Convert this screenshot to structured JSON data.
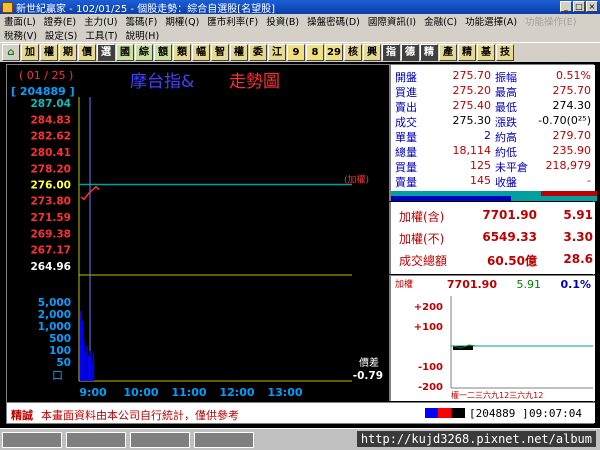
{
  "window": {
    "title": "新世紀贏家 - 102/01/25 - 個股走勢：綜合自選股[名望股]"
  },
  "menus": {
    "row1": [
      "畫面(L)",
      "證券(E)",
      "主力(U)",
      "籌碼(F)",
      "期權(Q)",
      "匯市利率(F)",
      "投資(B)",
      "操盤密碼(D)",
      "國際資訊(I)",
      "金融(C)",
      "功能選擇(A)",
      "功能操作(E)"
    ],
    "row2": [
      "稅務(V)",
      "設定(S)",
      "工具(T)",
      "說明(H)"
    ]
  },
  "toolbar": {
    "buttons": [
      "加",
      "權",
      "期",
      "價",
      "選",
      "國",
      "綜",
      "額",
      "類",
      "幅",
      "智",
      "權",
      "委",
      "江",
      "9",
      "8",
      "29",
      "核",
      "興",
      "指",
      "德",
      "精",
      "產",
      "精",
      "基",
      "技"
    ]
  },
  "chart": {
    "page": "( 01 / 25 )",
    "code": "[ 204889 ]",
    "title_a": "摩台指&",
    "title_b": "走勢圖",
    "ref_label": "(加權)",
    "diff_label": "價差",
    "diff_value": "-0.79",
    "volume_box": "口",
    "colors": {
      "up": "#ff3030",
      "down": "#00c000",
      "ref": "#ffffff",
      "axis": "#c0c000",
      "grid": "#00a0a0",
      "vol": "#0000ff"
    }
  },
  "chart_data": {
    "type": "line",
    "title": "摩台指& 走勢圖",
    "price_ticks": [
      "287.04",
      "284.83",
      "282.62",
      "280.41",
      "278.20",
      "276.00",
      "273.80",
      "271.59",
      "269.38",
      "267.17",
      "264.96"
    ],
    "volume_ticks": [
      "5,000",
      "2,000",
      "1,000",
      "500",
      "100",
      "50"
    ],
    "time_ticks": [
      "9:00",
      "10:00",
      "11:00",
      "12:00",
      "13:00"
    ],
    "ylim": [
      264.96,
      287.04
    ],
    "reference_price": 276.0,
    "series": [
      {
        "values": [
          274.3,
          274.0,
          274.5,
          275.0,
          275.3,
          275.7,
          275.3
        ]
      }
    ]
  },
  "quote": {
    "rows": [
      {
        "l1": "開盤",
        "v1": "275.70",
        "l2": "振幅",
        "v2": "0.51%"
      },
      {
        "l1": "買進",
        "v1": "275.20",
        "l2": "最高",
        "v2": "275.70"
      },
      {
        "l1": "賣出",
        "v1": "275.40",
        "l2": "最低",
        "v2": "274.30"
      },
      {
        "l1": "成交",
        "v1": "275.30",
        "l2": "漲跌",
        "v2": "-0.70(0²⁵)"
      },
      {
        "l1": "單量",
        "v1": "2",
        "l2": "約高",
        "v2": "279.70"
      },
      {
        "l1": "總量",
        "v1": "18,114",
        "l2": "約低",
        "v2": "235.90"
      },
      {
        "l1": "買量",
        "v1": "125",
        "l2": "未平倉",
        "v2": "218,979"
      },
      {
        "l1": "賣量",
        "v1": "145",
        "l2": "收盤",
        "v2": "-"
      }
    ]
  },
  "index_panel": {
    "rows": [
      {
        "label": "加權(含)",
        "value": "7701.90",
        "change": "5.91"
      },
      {
        "label": "加權(不)",
        "value": "6549.33",
        "change": "3.30"
      },
      {
        "label": "成交總額",
        "value": "60.50億",
        "change": "28.6"
      }
    ]
  },
  "mini": {
    "label": "加權",
    "value": "7701.90",
    "change": "5.91",
    "pct": "0.1%",
    "ticks": [
      "+200",
      "+100",
      "-100",
      "-200"
    ],
    "bottom_labels": "權一二三六九12三六九12"
  },
  "status": {
    "tag": "精誠",
    "message": "本畫面資料由本公司自行統計，僅供參考",
    "code": "[204889 ]",
    "time": "09:07:04"
  },
  "taskbar": {
    "url": "http://kujd3268.pixnet.net/album"
  }
}
